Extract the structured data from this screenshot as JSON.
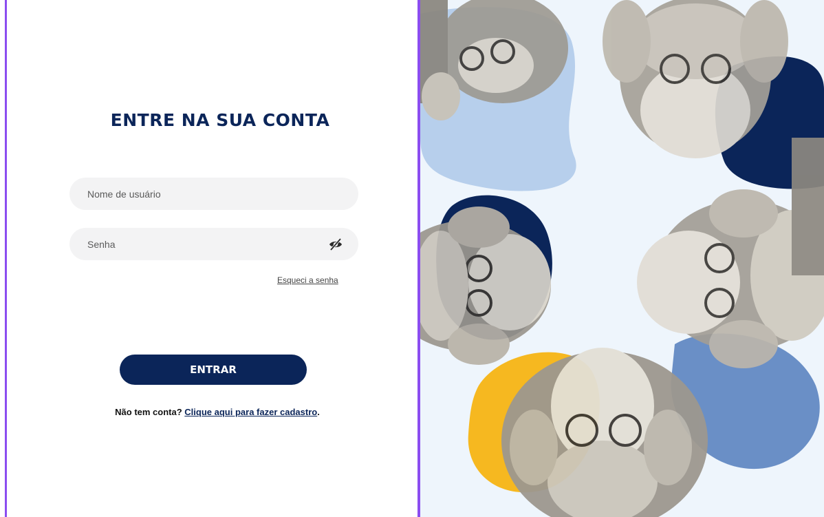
{
  "login": {
    "title": "ENTRE NA SUA CONTA",
    "username_placeholder": "Nome de usuário",
    "password_placeholder": "Senha",
    "forgot_password": "Esqueci a senha",
    "submit_label": "ENTRAR",
    "signup_prompt": "Não tem conta?",
    "signup_link": "Clique aqui para fazer cadastro",
    "signup_suffix": "."
  },
  "icons": {
    "password_toggle": "eye-slash-icon"
  },
  "colors": {
    "brand_navy": "#0b2559",
    "frame_purple": "#8b4df0",
    "input_bg": "#f3f3f4",
    "art_background": "#eef5fc",
    "blob_light_blue": "#b7cfec",
    "blob_mid_blue": "#6a8fc6",
    "blob_yellow": "#f6b820"
  }
}
